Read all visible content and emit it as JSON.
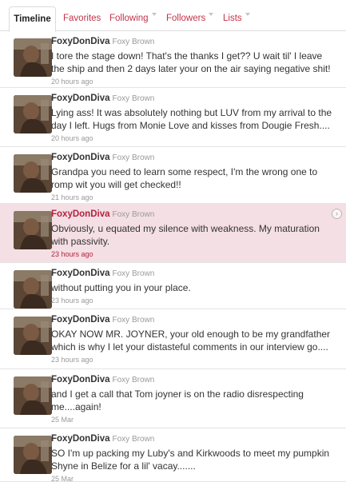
{
  "tabs": [
    {
      "label": "Timeline",
      "active": true
    },
    {
      "label": "Favorites"
    },
    {
      "label": "Following"
    },
    {
      "label": "Followers"
    },
    {
      "label": "Lists"
    }
  ],
  "tweets": [
    {
      "screen_name": "FoxyDonDiva",
      "full_name": "Foxy Brown",
      "lines": [
        "I tore the stage down! That's the thanks I get?? U wait til' I leave",
        "the ship and then 2 days later your on the air saying negative shit!"
      ],
      "time": "20 hours ago"
    },
    {
      "screen_name": "FoxyDonDiva",
      "full_name": "Foxy Brown",
      "lines": [
        "Lying ass! It was absolutely nothing but LUV from my arrival to the",
        "day I left. Hugs from Monie Love and kisses from Dougie Fresh...."
      ],
      "time": "20 hours ago"
    },
    {
      "screen_name": "FoxyDonDiva",
      "full_name": "Foxy Brown",
      "lines": [
        "Grandpa you need to learn some respect, I'm the wrong one to",
        "romp wit you will get checked!!"
      ],
      "time": "21 hours ago"
    },
    {
      "screen_name": "FoxyDonDiva",
      "full_name": "Foxy Brown",
      "lines": [
        "Obviously, u equated my silence with weakness. My maturation",
        "with passivity."
      ],
      "time": "23 hours ago",
      "highlighted": true
    },
    {
      "screen_name": "FoxyDonDiva",
      "full_name": "Foxy Brown",
      "lines": [
        "without putting you in your place."
      ],
      "time": "23 hours ago"
    },
    {
      "screen_name": "FoxyDonDiva",
      "full_name": "Foxy Brown",
      "lines": [
        "OKAY NOW MR. JOYNER, your old enough to be my grandfather",
        "which is why I let your distasteful comments in our interview go...."
      ],
      "time": "23 hours ago"
    },
    {
      "screen_name": "FoxyDonDiva",
      "full_name": "Foxy Brown",
      "lines": [
        "and I get a call that Tom joyner is on the radio disrespecting",
        "me....again!"
      ],
      "time": "25 Mar"
    },
    {
      "screen_name": "FoxyDonDiva",
      "full_name": "Foxy Brown",
      "lines": [
        "SO I'm up packing my Luby's and Kirkwoods to meet my pumpkin",
        "Shyne in Belize for a lil' vacay......."
      ],
      "time": "25 Mar"
    }
  ],
  "icons": {
    "dropdown": "chevron-down-icon",
    "tweet_action": "chevron-right-icon",
    "avatar": "profile-photo"
  },
  "colors": {
    "link": "#c2334a",
    "highlight_bg": "#f4dfe4",
    "highlight_text": "#b3223f",
    "meta": "#999999"
  }
}
